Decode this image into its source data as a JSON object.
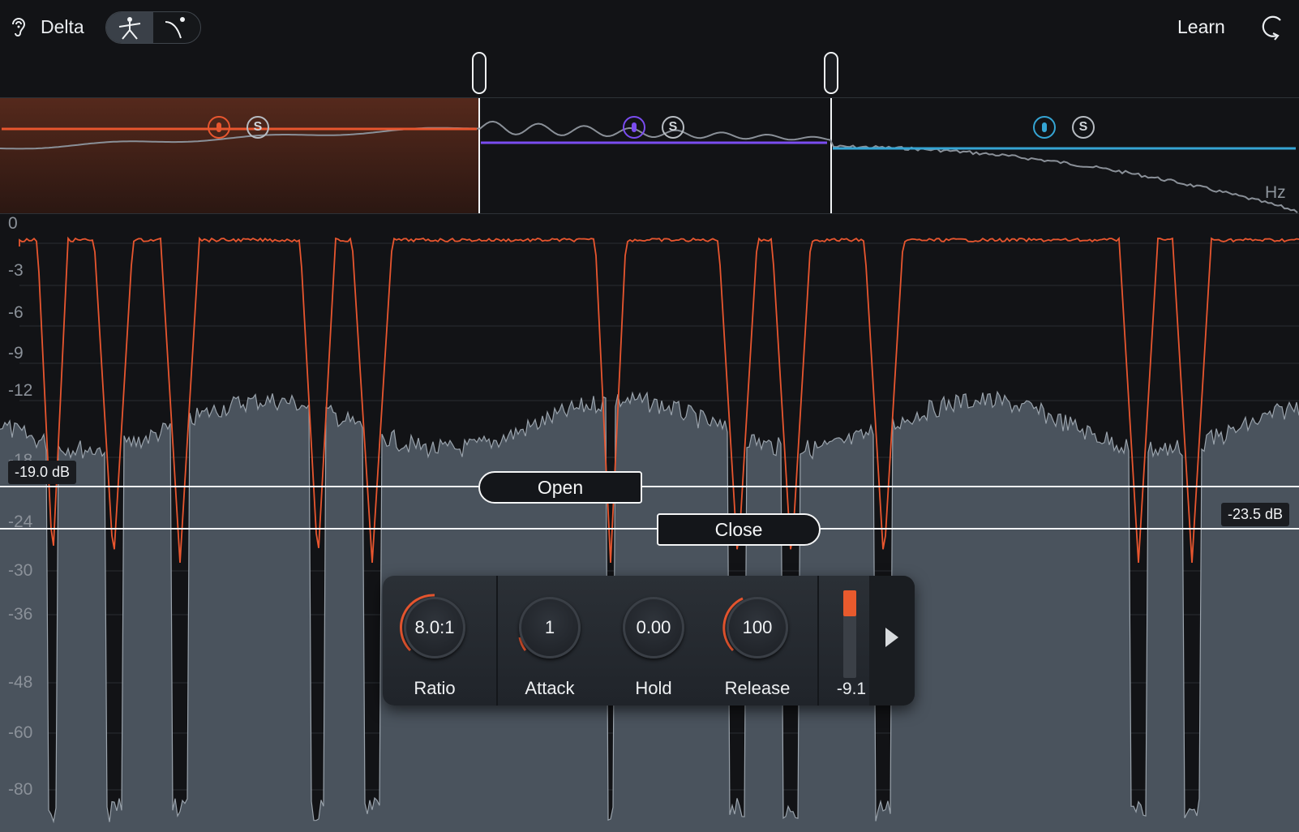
{
  "header": {
    "delta_label": "Delta",
    "learn_label": "Learn"
  },
  "crossover": {
    "hz_label": "Hz",
    "bands": [
      {
        "color": "#e8562f",
        "solo": "S"
      },
      {
        "color": "#7a4cf0",
        "solo": "S"
      },
      {
        "color": "#35a5d4",
        "solo": "S"
      }
    ]
  },
  "meter_axis": {
    "labels": [
      "0",
      "-3",
      "-6",
      "-9",
      "-12",
      "-18",
      "-24",
      "-30",
      "-36",
      "-48",
      "-60",
      "-80"
    ]
  },
  "thresholds": {
    "open_label": "Open",
    "close_label": "Close",
    "open_value": "-19.0 dB",
    "close_value": "-23.5 dB"
  },
  "controls": {
    "ratio": {
      "value": "8.0:1",
      "label": "Ratio"
    },
    "attack": {
      "value": "1",
      "label": "Attack"
    },
    "hold": {
      "value": "0.00",
      "label": "Hold"
    },
    "release": {
      "value": "100",
      "label": "Release"
    },
    "meter_value": "-9.1",
    "meter_level": 0.3
  },
  "colors": {
    "accent": "#e8562f",
    "waveform_fill": "#4a535d",
    "waveform_line": "#9aa3ac"
  }
}
